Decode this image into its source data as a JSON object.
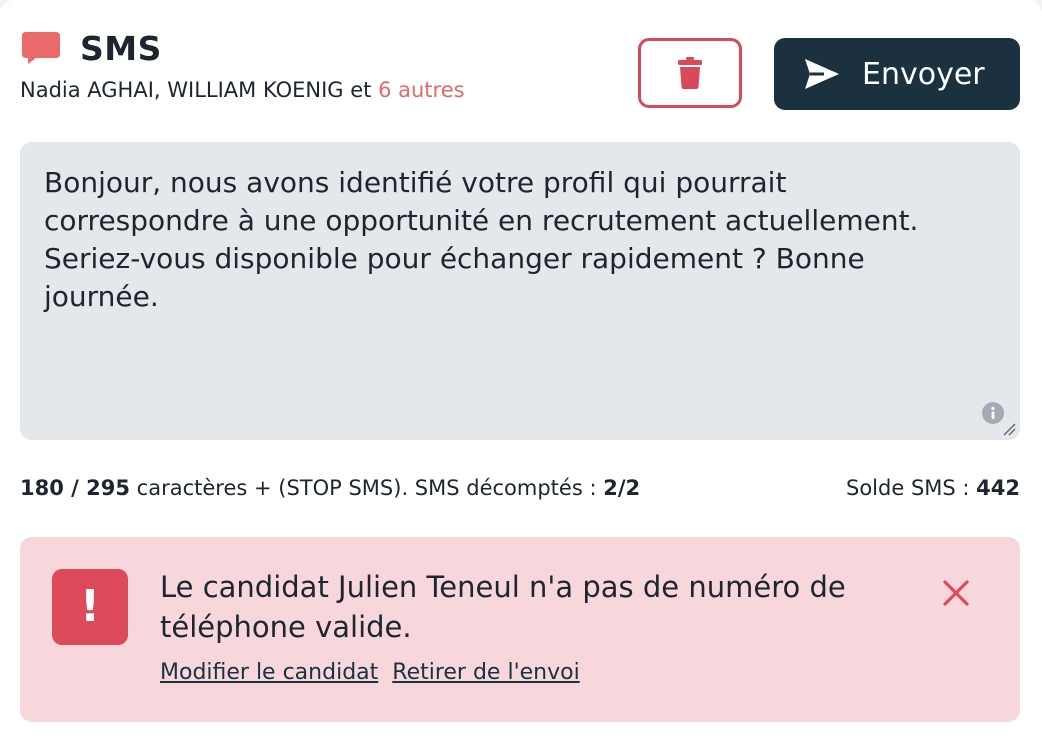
{
  "header": {
    "title": "SMS",
    "recipients_names": "Nadia AGHAI, WILLIAM KOENIG et ",
    "recipients_more": "6 autres",
    "icon": "chat-bubble-icon",
    "accent_color": "#ea6a6b"
  },
  "actions": {
    "delete_icon": "trash-icon",
    "send_label": "Envoyer",
    "send_icon": "paper-plane-icon",
    "send_bg_color": "#1b3140",
    "delete_border_color": "#d84a59"
  },
  "message": {
    "text": "Bonjour, nous avons identifié votre profil qui pourrait correspondre à une opportunité en recrutement actuellement. Seriez-vous disponible pour échanger rapidement ? Bonne journée.",
    "info_icon": "info-icon"
  },
  "counter": {
    "chars_used": "180",
    "chars_sep": " / ",
    "chars_max": "295",
    "chars_text": " caractères + (STOP SMS). SMS décomptés : ",
    "sms_count": "2/2",
    "balance_label": "Solde SMS : ",
    "balance_value": "442"
  },
  "alert": {
    "badge": "!",
    "message": "Le candidat Julien Teneul n'a pas de numéro de téléphone valide.",
    "link_edit": "Modifier le candidat",
    "link_remove": "Retirer de l'envoi",
    "close_icon": "close-icon",
    "bg_color": "#f8d7dc",
    "badge_color": "#dc4a5b"
  }
}
